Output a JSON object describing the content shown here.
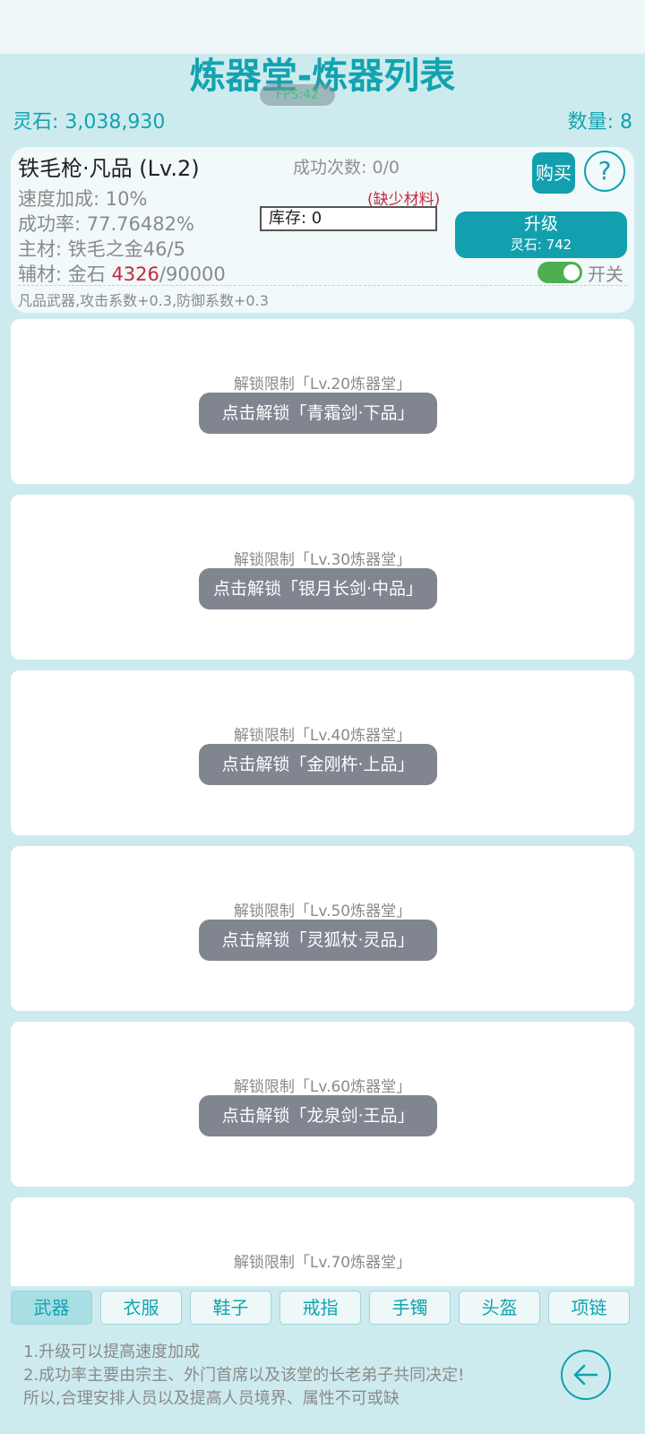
{
  "header": {
    "title": "炼器堂-炼器列表",
    "fps": "FPS:42",
    "stone_total": "灵石: 3,038,930",
    "count_total": "数量: 8"
  },
  "item": {
    "name": "铁毛枪·凡品 (Lv.2)",
    "success_count": "成功次数: 0/0",
    "buy_label": "购买",
    "help_symbol": "?",
    "speed_bonus": "速度加成: 10%",
    "success_rate": "成功率: 77.76482%",
    "main_material": "主材: 铁毛之金46/5",
    "aux_material_prefix": "辅材: 金石 ",
    "aux_material_have": "4326",
    "aux_material_need": "/90000",
    "lacking_notice": "(缺少材料)",
    "stock": "库存: 0",
    "upgrade_label": "升级",
    "upgrade_cost": "灵石: 742",
    "toggle_label": "开关",
    "toggle_on": true,
    "description": "凡品武器,攻击系数+0.3,防御系数+0.3"
  },
  "locked_items": [
    {
      "limit": "解锁限制「Lv.20炼器堂」",
      "button": "点击解锁「青霜剑·下品」"
    },
    {
      "limit": "解锁限制「Lv.30炼器堂」",
      "button": "点击解锁「银月长剑·中品」"
    },
    {
      "limit": "解锁限制「Lv.40炼器堂」",
      "button": "点击解锁「金刚杵·上品」"
    },
    {
      "limit": "解锁限制「Lv.50炼器堂」",
      "button": "点击解锁「灵狐杖·灵品」"
    },
    {
      "limit": "解锁限制「Lv.60炼器堂」",
      "button": "点击解锁「龙泉剑·王品」"
    },
    {
      "limit": "解锁限制「Lv.70炼器堂」",
      "button": ""
    }
  ],
  "tabs": [
    "武器",
    "衣服",
    "鞋子",
    "戒指",
    "手镯",
    "头盔",
    "项链"
  ],
  "active_tab": "武器",
  "tips": [
    "1.升级可以提高速度加成",
    "2.成功率主要由宗主、外门首席以及该堂的长老弟子共同决定!",
    "所以,合理安排人员以及提高人员境界、属性不可或缺"
  ],
  "colors": {
    "accent": "#12a0ae",
    "background": "#cdebee",
    "warning": "#c8283f",
    "toggle_on": "#4caf50",
    "locked_button": "#818590"
  },
  "icons": {
    "help": "question-circle-icon",
    "back": "arrow-left-circle-icon"
  }
}
